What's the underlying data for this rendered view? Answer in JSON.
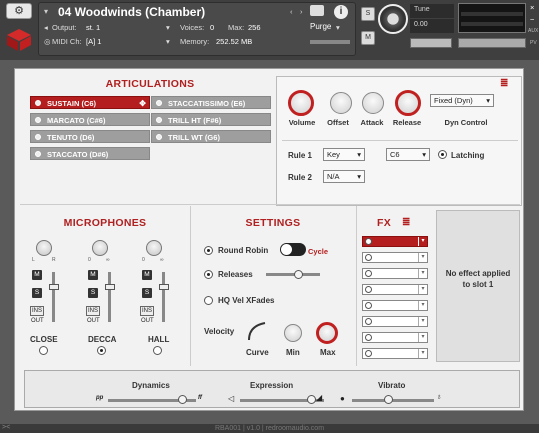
{
  "header": {
    "instrument_title": "04 Woodwinds (Chamber)",
    "output_label": "Output:",
    "output_value": "st. 1",
    "voices_label": "Voices:",
    "voices_value": "0",
    "max_label": "Max:",
    "max_value": "256",
    "purge_label": "Purge",
    "midi_label": "MIDI Ch:",
    "midi_value": "[A] 1",
    "memory_label": "Memory:",
    "memory_value": "252.52 MB",
    "s_label": "S",
    "m_label": "M",
    "tune_label": "Tune",
    "tune_value": "0.00",
    "aux_label": "AUX",
    "pv_label": "PV",
    "close_glyph": "×",
    "minus_glyph": "−",
    "arrow_left": "‹",
    "arrow_right": "›"
  },
  "articulations": {
    "title": "ARTICULATIONS",
    "left": [
      "SUSTAIN (C6)",
      "MARCATO (C#6)",
      "TENUTO (D6)",
      "STACCATO (D#6)"
    ],
    "right": [
      "STACCATISSIMO (E6)",
      "TRILL HT (F#6)",
      "TRILL WT (G6)"
    ],
    "selected": "SUSTAIN (C6)"
  },
  "params": {
    "knobs": [
      "Volume",
      "Offset",
      "Attack",
      "Release"
    ],
    "dyn_value": "Fixed (Dyn)",
    "dyn_label": "Dyn Control",
    "rule1_label": "Rule 1",
    "rule1_type": "Key",
    "rule1_key": "C6",
    "latching": "Latching",
    "rule2_label": "Rule 2",
    "rule2_type": "N/A"
  },
  "microphones": {
    "title": "MICROPHONES",
    "mics": [
      {
        "name": "CLOSE",
        "l": "L",
        "r": "R",
        "selected": false
      },
      {
        "name": "DECCA",
        "l": "0",
        "r": "∞",
        "selected": true
      },
      {
        "name": "HALL",
        "l": "0",
        "r": "∞",
        "selected": false
      }
    ],
    "m": "M",
    "s": "S",
    "ins": "INS",
    "out": "OUT"
  },
  "settings": {
    "title": "SETTINGS",
    "round_robin": "Round Robin",
    "cycle": "Cycle",
    "releases": "Releases",
    "hq_vel": "HQ Vel XFades",
    "velocity": "Velocity",
    "curve": "Curve",
    "min": "Min",
    "max": "Max"
  },
  "fx": {
    "title": "FX",
    "slots": 8,
    "empty_text": "No effect applied to slot 1"
  },
  "bottom": {
    "dynamics": "Dynamics",
    "dyn_min": "pp",
    "dyn_max": "ff",
    "dynamics_level": 0.85,
    "expression": "Expression",
    "expression_level": 0.85,
    "vibrato": "Vibrato",
    "vibrato_level": 0.45
  },
  "footer": "RBA001 | v1.0 | redroomaudio.com",
  "colors": {
    "accent": "#b51e1e"
  }
}
